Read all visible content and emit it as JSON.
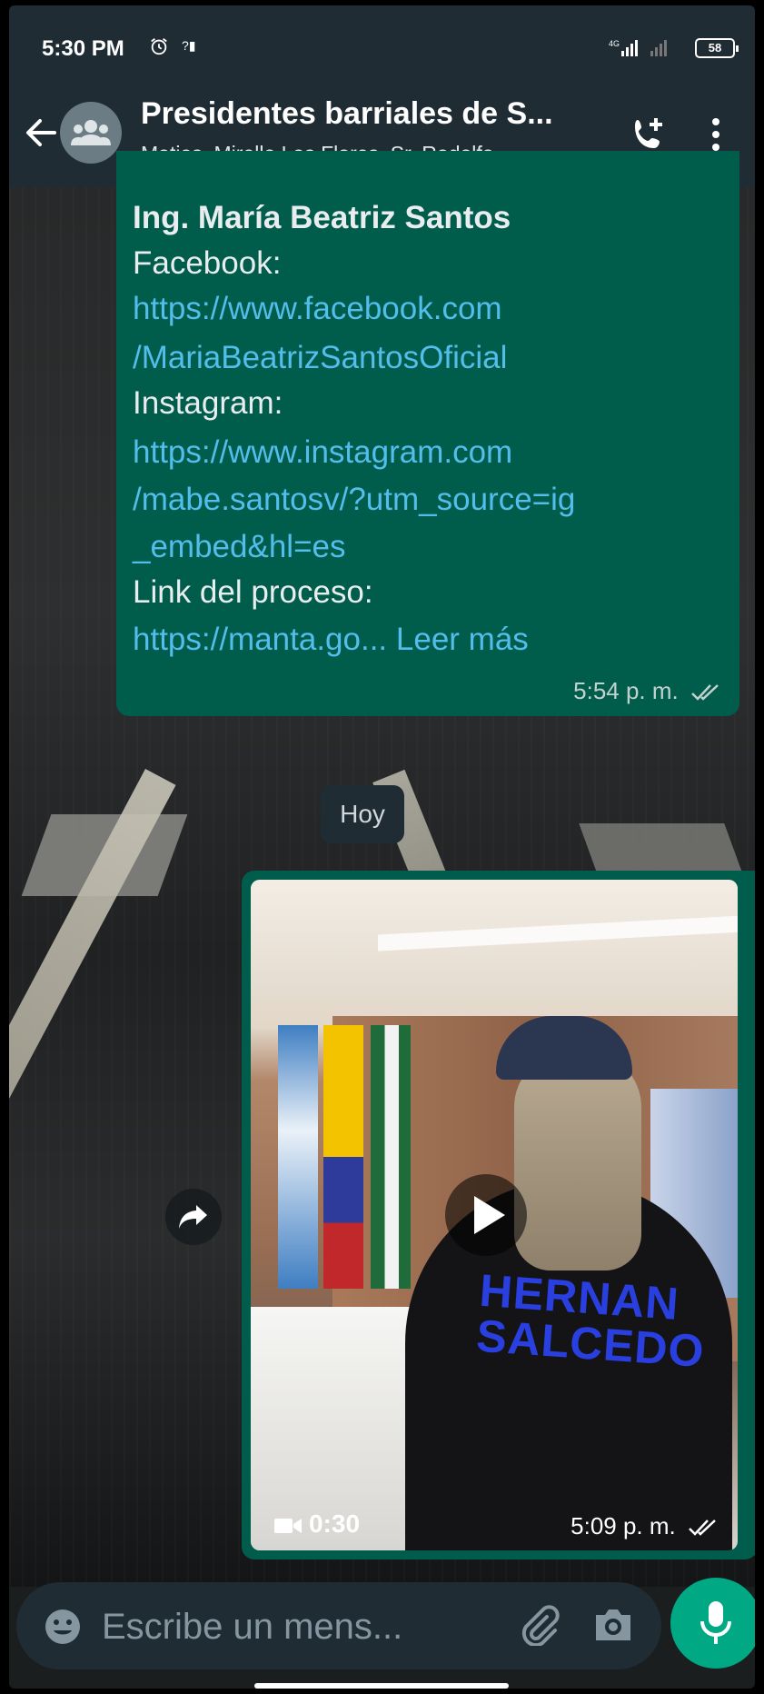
{
  "status_bar": {
    "time": "5:30 PM",
    "network": "4G",
    "battery": "58"
  },
  "header": {
    "title": "Presidentes barriales de S...",
    "subtitle": "Matias, Mirella Las Flores, Sr. Rodolfo ..."
  },
  "message_text": {
    "lines": [
      {
        "text": "Ing. María Beatriz Santos",
        "style": "bold"
      },
      {
        "text": "Facebook:",
        "style": "normal"
      },
      {
        "text": "https://www.facebook.com",
        "style": "link"
      },
      {
        "text": "/MariaBeatrizSantosOficial",
        "style": "link"
      },
      {
        "text": "Instagram:",
        "style": "normal"
      },
      {
        "text": "https://www.instagram.com",
        "style": "link"
      },
      {
        "text": "/mabe.santosv/?utm_source=ig",
        "style": "link"
      },
      {
        "text": "_embed&hl=es",
        "style": "link"
      },
      {
        "text": "Link del proceso:",
        "style": "normal"
      },
      {
        "text": "https://manta.go...",
        "style": "link"
      }
    ],
    "read_more": "Leer más",
    "time": "5:54 p. m."
  },
  "date_divider": "Hoy",
  "message_video": {
    "duration": "0:30",
    "time": "5:09 p. m.",
    "shirt_text_1": "HERNAN",
    "shirt_text_2": "SALCEDO"
  },
  "input": {
    "placeholder": "Escribe un mens..."
  },
  "colors": {
    "header_bg": "#1f2c34",
    "outgoing_bubble": "#005c4b",
    "link": "#53bdeb",
    "mic_button": "#00a884"
  },
  "icons": [
    "back-arrow-icon",
    "group-icon",
    "call-add-icon",
    "menu-icon",
    "ticks-icon",
    "forward-icon",
    "play-icon",
    "video-camera-icon",
    "emoji-icon",
    "attach-icon",
    "camera-icon",
    "mic-icon",
    "alarm-icon"
  ]
}
